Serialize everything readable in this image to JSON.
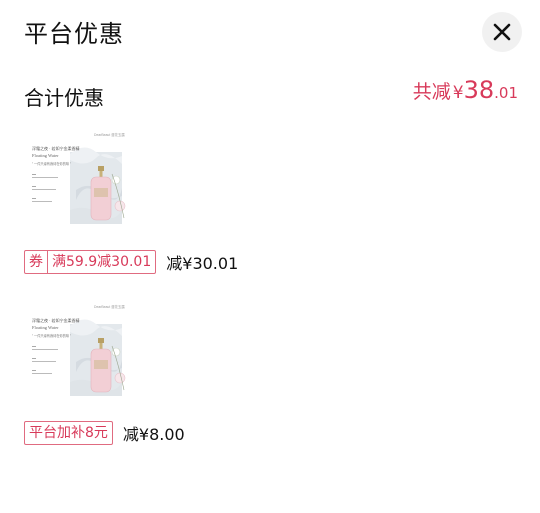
{
  "header": {
    "title": "平台优惠"
  },
  "summary": {
    "label": "合计优惠",
    "total_prefix": "共减",
    "currency": "¥",
    "total_int": "38",
    "total_dec": ".01"
  },
  "items": [
    {
      "coupon_prefix": "券",
      "coupon_label": "满59.9减30.01",
      "discount": "减¥30.01",
      "product_image": {
        "brand": "DearBeaut 漫花玉露",
        "name_cn": "浮霜之夜 · 若如宁金柔香精",
        "name_en": "Floating Water",
        "quote": "\" 一件只缘有我待在你的味 \""
      }
    },
    {
      "coupon_label": "平台加补8元",
      "discount": "减¥8.00",
      "product_image": {
        "brand": "DearBeaut 漫花玉露",
        "name_cn": "浮霜之夜 · 若如宁金柔香精",
        "name_en": "Floating Water",
        "quote": "\" 一件只缘有我待在你的味 \""
      }
    }
  ],
  "colors": {
    "accent": "#d83a5a",
    "tag_border": "#e06b80",
    "close_bg": "#f1f1f1"
  },
  "icons": {
    "close": "close-icon"
  }
}
